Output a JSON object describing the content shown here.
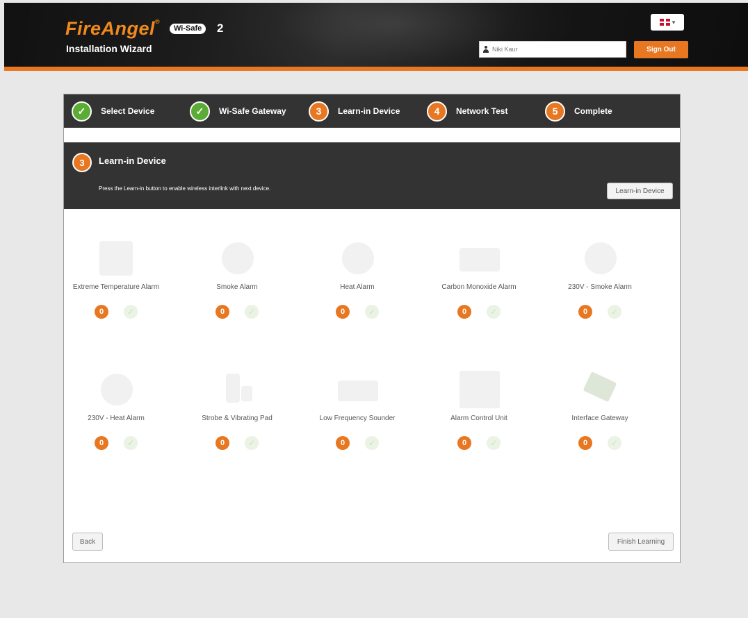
{
  "header": {
    "brand": "FireAngel",
    "product_badge": "Wi-Safe",
    "product_version": "2",
    "app_title": "Installation Wizard",
    "language_flag": "uk-flag-icon",
    "username_value": "Niki Kaur",
    "signout_label": "Sign Out"
  },
  "steps": [
    {
      "number": "✓",
      "label": "Select Device",
      "state": "done"
    },
    {
      "number": "✓",
      "label": "Wi-Safe Gateway",
      "state": "done"
    },
    {
      "number": "3",
      "label": "Learn-in Device",
      "state": "current"
    },
    {
      "number": "4",
      "label": "Network Test",
      "state": "pending"
    },
    {
      "number": "5",
      "label": "Complete",
      "state": "pending"
    }
  ],
  "panel": {
    "number": "3",
    "title": "Learn-in Device",
    "description": "Press the Learn-in button to enable wireless interlink with next device.",
    "learnin_button": "Learn-in Device"
  },
  "devices": [
    {
      "name": "Extreme Temperature Alarm",
      "count": "0",
      "icon": "heat-sensor-icon"
    },
    {
      "name": "Smoke Alarm",
      "count": "0",
      "icon": "smoke-alarm-icon"
    },
    {
      "name": "Heat Alarm",
      "count": "0",
      "icon": "heat-alarm-icon"
    },
    {
      "name": "Carbon Monoxide Alarm",
      "count": "0",
      "icon": "co-alarm-icon"
    },
    {
      "name": "230V - Smoke Alarm",
      "count": "0",
      "icon": "mains-smoke-alarm-icon"
    },
    {
      "name": "230V - Heat Alarm",
      "count": "0",
      "icon": "mains-heat-alarm-icon"
    },
    {
      "name": "Strobe & Vibrating Pad",
      "count": "0",
      "icon": "strobe-pad-icon"
    },
    {
      "name": "Low Frequency Sounder",
      "count": "0",
      "icon": "sounder-icon"
    },
    {
      "name": "Alarm Control Unit",
      "count": "0",
      "icon": "control-unit-icon"
    },
    {
      "name": "Interface Gateway",
      "count": "0",
      "icon": "gateway-icon"
    }
  ],
  "footer": {
    "back_label": "Back",
    "finish_label": "Finish Learning"
  },
  "colors": {
    "accent": "#e87722",
    "done": "#5aac35",
    "dark": "#333333"
  }
}
